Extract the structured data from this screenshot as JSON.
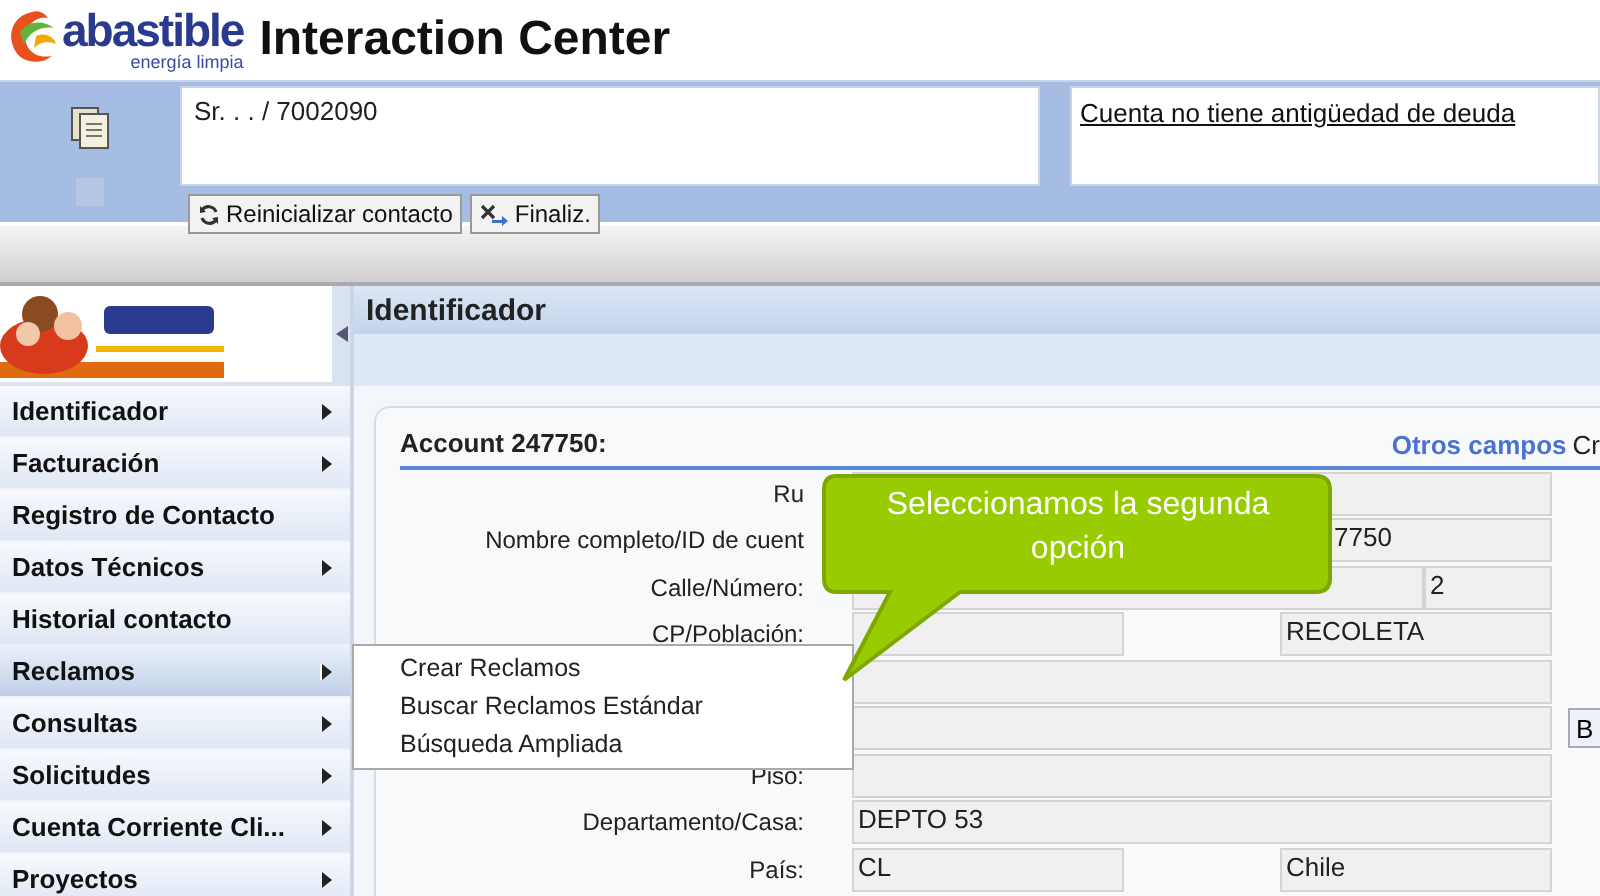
{
  "header": {
    "logo_name": "abastible",
    "logo_tagline": "energía limpia",
    "title": "Interaction Center"
  },
  "contact_bar": {
    "contact": "Sr. . . / 7002090",
    "notice": "Cuenta no tiene antigüedad de deuda",
    "buttons": [
      {
        "label": "Reinicializar contacto",
        "kind": "refresh"
      },
      {
        "label": "Finaliz.",
        "kind": "end"
      }
    ]
  },
  "sidebar": {
    "items": [
      {
        "label": "Identificador",
        "submenu": true,
        "selected": false
      },
      {
        "label": "Facturación",
        "submenu": true,
        "selected": false
      },
      {
        "label": "Registro de Contacto",
        "submenu": false,
        "selected": false
      },
      {
        "label": "Datos Técnicos",
        "submenu": true,
        "selected": false
      },
      {
        "label": "Historial contacto",
        "submenu": false,
        "selected": false
      },
      {
        "label": "Reclamos",
        "submenu": true,
        "selected": true
      },
      {
        "label": "Consultas",
        "submenu": true,
        "selected": false
      },
      {
        "label": "Solicitudes",
        "submenu": true,
        "selected": false
      },
      {
        "label": "Cuenta Corriente Cli...",
        "submenu": true,
        "selected": false
      },
      {
        "label": "Proyectos",
        "submenu": true,
        "selected": false
      }
    ]
  },
  "submenu": {
    "items": [
      "Crear Reclamos",
      "Buscar Reclamos Estándar",
      "Búsqueda Ampliada"
    ]
  },
  "page": {
    "title": "Identificador",
    "account": "Account 247750:",
    "link": "Otros campos",
    "link_after": "Cr",
    "rows": [
      {
        "label": "Ru",
        "fields": [
          {
            "kind": "full"
          }
        ]
      },
      {
        "label": "Nombre completo/ID de cuent",
        "fields": [
          {
            "kind": "full",
            "value": "7750"
          }
        ]
      },
      {
        "label": "Calle/Número:",
        "fields": [
          {
            "kind": "long"
          },
          {
            "kind": "short",
            "value": "2"
          }
        ]
      },
      {
        "label": "CP/Población:",
        "fields": [
          {
            "kind": "half"
          },
          {
            "kind": "half",
            "value": "RECOLETA"
          }
        ]
      },
      {
        "fields": [
          {
            "kind": "full"
          }
        ]
      },
      {
        "fields": [
          {
            "kind": "full"
          }
        ],
        "button": "B"
      },
      {
        "label": "Piso:",
        "fields": [
          {
            "kind": "full"
          }
        ]
      },
      {
        "label": "Departamento/Casa:",
        "fields": [
          {
            "kind": "full",
            "value": "DEPTO 53"
          }
        ]
      },
      {
        "label": "País:",
        "fields": [
          {
            "kind": "half",
            "value": "CL"
          },
          {
            "kind": "half",
            "value": "Chile"
          }
        ]
      }
    ]
  },
  "callout": {
    "text": "Seleccionamos la segunda opción"
  }
}
